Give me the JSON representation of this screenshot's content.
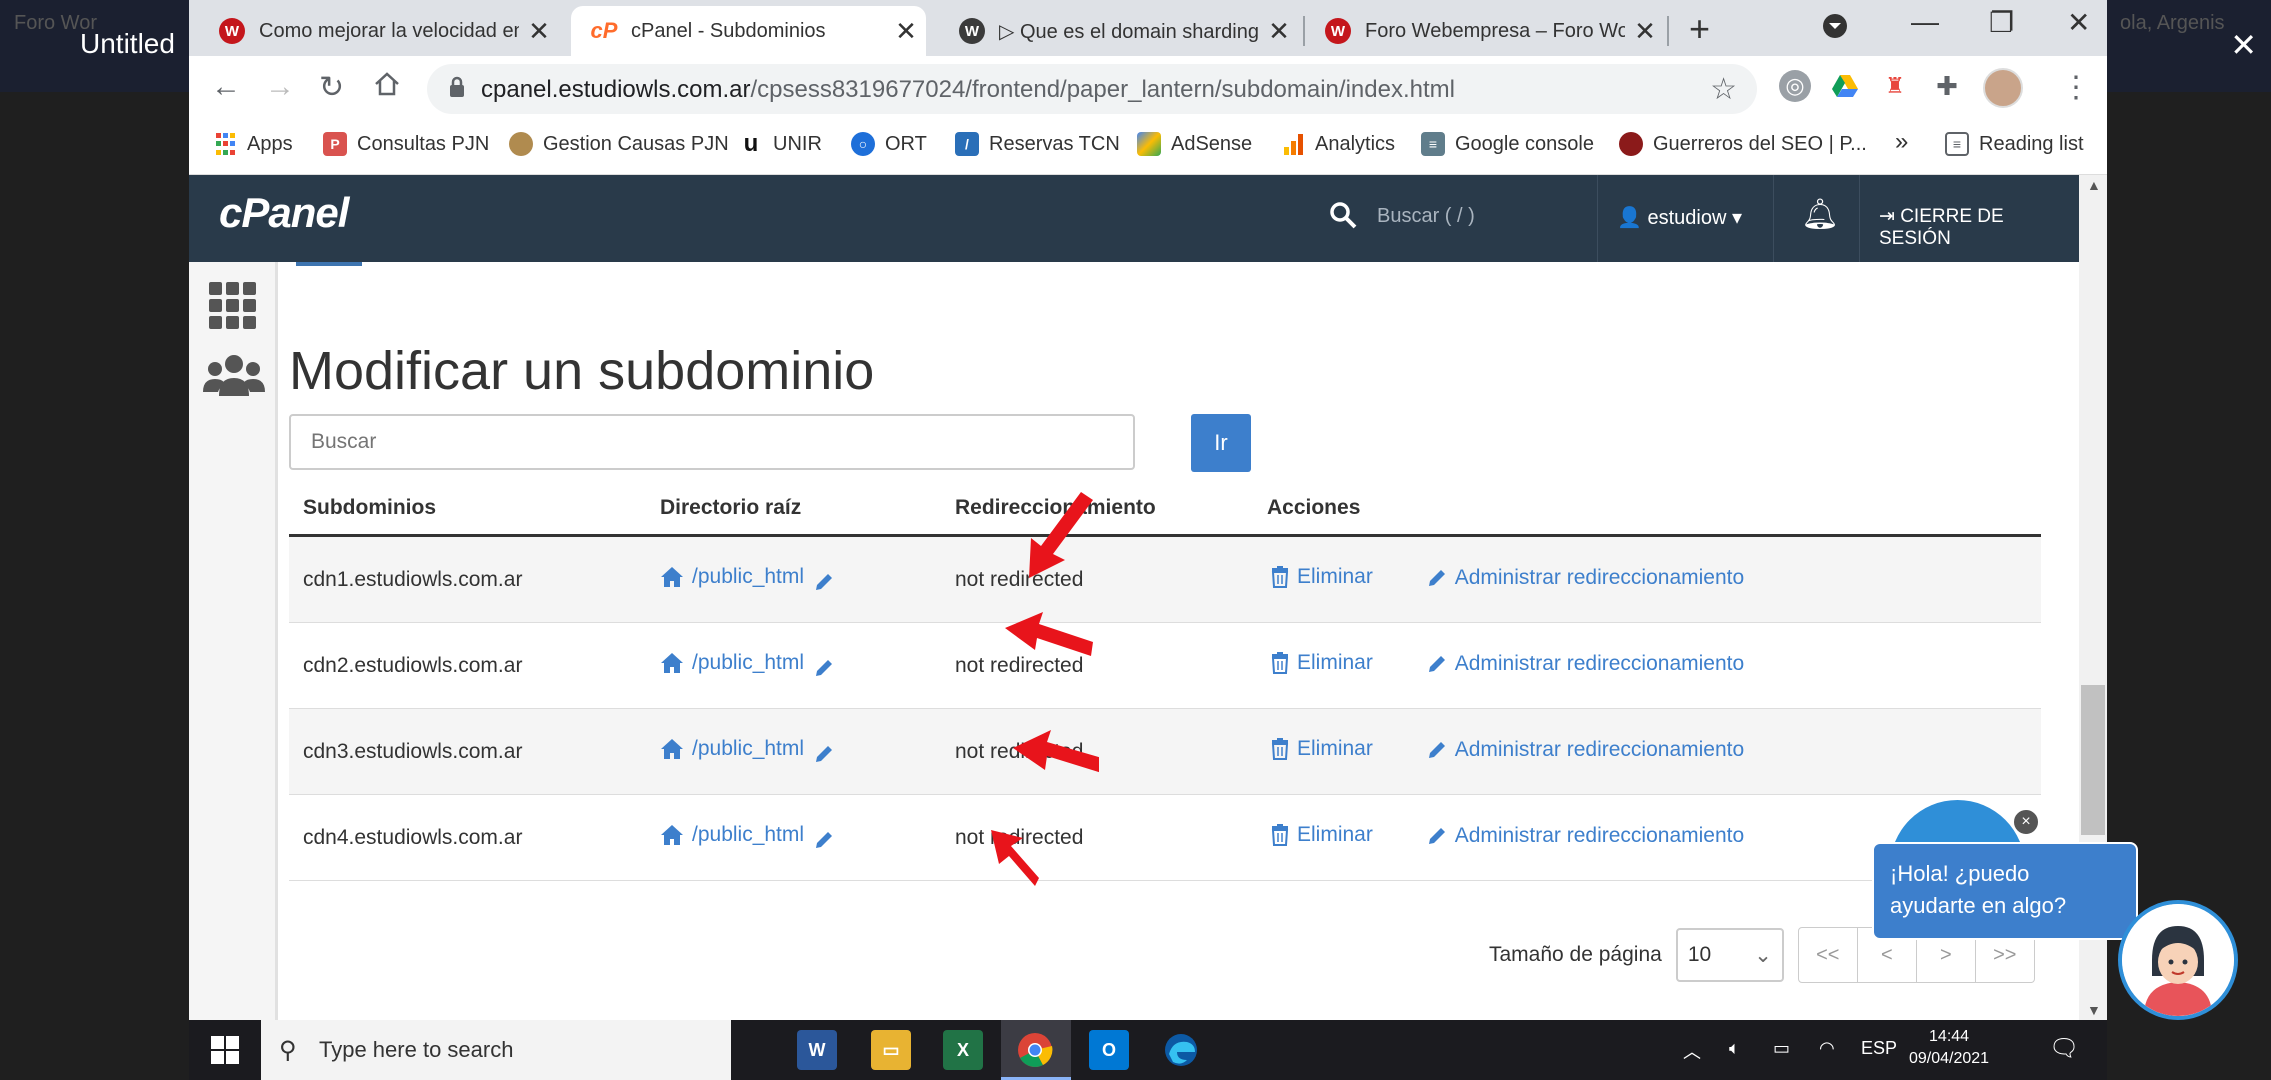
{
  "outer": {
    "title": "Untitled",
    "dim_left": "Foro Wor",
    "dim_right": "ola, Argenis"
  },
  "browser": {
    "tabs": [
      {
        "title": "Como mejorar la velocidad en",
        "favicon": "wp-red"
      },
      {
        "title": "cPanel - Subdominios",
        "favicon": "cpanel",
        "active": true
      },
      {
        "title": "▷ Que es el domain sharding y",
        "favicon": "wordpress"
      },
      {
        "title": "Foro Webempresa – Foro Wor",
        "favicon": "wp-red"
      }
    ],
    "url_host": "cpanel.estudiowls.com.ar",
    "url_path": "/cpsess8319677024/frontend/paper_lantern/subdomain/index.html",
    "bookmarks": [
      {
        "label": "Apps",
        "color": "#4285f4"
      },
      {
        "label": "Consultas PJN",
        "color": "#d9534f"
      },
      {
        "label": "Gestion Causas PJN",
        "color": "#b08b4f"
      },
      {
        "label": "UNIR",
        "color": "#111111"
      },
      {
        "label": "ORT",
        "color": "#1e6fd9"
      },
      {
        "label": "Reservas TCN",
        "color": "#2a6fb8"
      },
      {
        "label": "AdSense",
        "color": "#fbbc04"
      },
      {
        "label": "Analytics",
        "color": "#f57c00"
      },
      {
        "label": "Google console",
        "color": "#607d8b"
      },
      {
        "label": "Guerreros del SEO | P...",
        "color": "#8b1a1a"
      }
    ],
    "bookmarks_more": "»",
    "reading_list": "Reading list"
  },
  "cpanel": {
    "logo": "cPanel",
    "search_placeholder": "Buscar ( / )",
    "user": "estudiow",
    "logout": "CIERRE DE SESIÓN",
    "title": "Modificar un subdominio",
    "search_box_placeholder": "Buscar",
    "go_button": "Ir",
    "columns": [
      "Subdominios",
      "Directorio raíz",
      "Redireccionamiento",
      "Acciones"
    ],
    "rows": [
      {
        "subdomain": "cdn1.estudiowls.com.ar",
        "dir": "/public_html",
        "redirect": "not redirected"
      },
      {
        "subdomain": "cdn2.estudiowls.com.ar",
        "dir": "/public_html",
        "redirect": "not redirected"
      },
      {
        "subdomain": "cdn3.estudiowls.com.ar",
        "dir": "/public_html",
        "redirect": "not redirected"
      },
      {
        "subdomain": "cdn4.estudiowls.com.ar",
        "dir": "/public_html",
        "redirect": "not redirected"
      }
    ],
    "action_delete": "Eliminar",
    "action_manage": "Administrar redireccionamiento",
    "page_size_label": "Tamaño de página",
    "page_size_value": "10",
    "pager_buttons": [
      "<<",
      "<",
      ">",
      ">>"
    ]
  },
  "chat": {
    "line1": "¡Hola! ¿puedo",
    "line2": "ayudarte en algo?",
    "close": "×"
  },
  "taskbar": {
    "search": "Type here to search",
    "lang": "ESP",
    "time": "14:44",
    "date": "09/04/2021"
  },
  "colors": {
    "accent": "#3d7fcc",
    "header": "#293a4a",
    "annotation_arrow": "#e8141b"
  }
}
